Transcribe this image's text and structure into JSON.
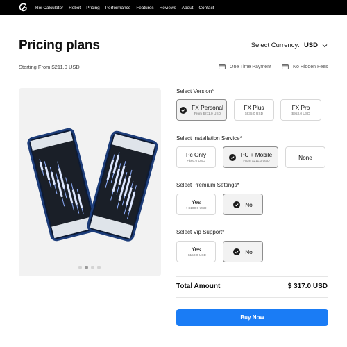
{
  "nav": {
    "logo_icon": "brand-logo-icon",
    "links": [
      "Roi Calculator",
      "Robot",
      "Pricing",
      "Performance",
      "Features",
      "Reviews",
      "About",
      "Contact"
    ]
  },
  "header": {
    "title": "Pricing plans",
    "currency_label": "Select Currency:",
    "currency_value": "USD"
  },
  "summary": {
    "starting": "Starting From $211.0 USD",
    "features": [
      {
        "icon": "card-icon",
        "label": "One Time Payment"
      },
      {
        "icon": "card-icon",
        "label": "No Hidden Fees"
      }
    ]
  },
  "gallery": {
    "slides": 4,
    "active_slide": 2
  },
  "sections": {
    "version": {
      "label": "Select Version*",
      "options": [
        {
          "name": "FX Personal",
          "sub": "From $211.0 USD",
          "selected": true
        },
        {
          "name": "FX Plus",
          "sub": "$635.0 USD",
          "selected": false
        },
        {
          "name": "FX Pro",
          "sub": "$953.0 USD",
          "selected": false
        }
      ]
    },
    "installation": {
      "label": "Select Installation Service*",
      "options": [
        {
          "name": "Pc Only",
          "sub": "+$60.0 USD",
          "selected": false
        },
        {
          "name": "PC + Mobile",
          "sub": "From $211.0 USD",
          "selected": true
        },
        {
          "name": "None",
          "sub": "",
          "selected": false
        }
      ]
    },
    "premium": {
      "label": "Select Premium Settings*",
      "options": [
        {
          "name": "Yes",
          "sub": "+ $100.0 USD",
          "selected": false
        },
        {
          "name": "No",
          "sub": "",
          "selected": true
        }
      ]
    },
    "vip": {
      "label": "Select Vip Support*",
      "options": [
        {
          "name": "Yes",
          "sub": "+$150.0 USD",
          "selected": false
        },
        {
          "name": "No",
          "sub": "",
          "selected": true
        }
      ]
    }
  },
  "total": {
    "label": "Total Amount",
    "value": "$ 317.0 USD"
  },
  "cta": {
    "label": "Buy Now",
    "color": "#1a7cf5"
  }
}
